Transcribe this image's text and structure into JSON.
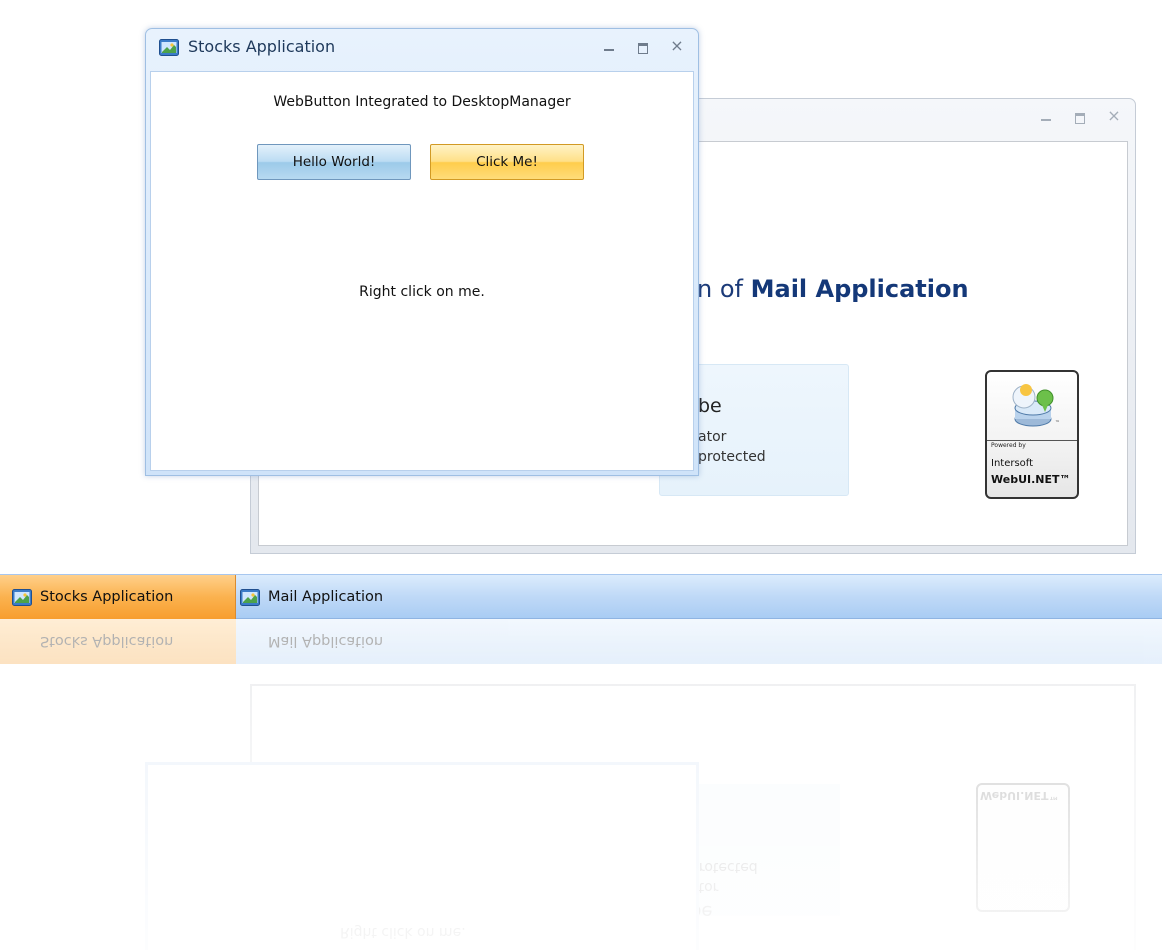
{
  "windows": {
    "stocks": {
      "title": "Stocks Application",
      "caption": "WebButton Integrated to DesktopManager",
      "hello_button": "Hello World!",
      "click_button": "Click Me!",
      "right_click_text": "Right click on me."
    },
    "mail": {
      "heading_partial": "n of ",
      "heading_app": "Mail Application",
      "welcome_title_partial": "be",
      "welcome_role_partial": "ator",
      "welcome_note_partial": "protected",
      "powered_by": "Powered by",
      "powered_company": "Intersoft",
      "powered_product": "WebUI.NET™",
      "powered_tm": "™"
    }
  },
  "taskbar": {
    "items": [
      {
        "label": "Stocks Application",
        "active": true
      },
      {
        "label": "Mail Application",
        "active": false
      }
    ]
  },
  "window_controls": {
    "minimize": "minimize",
    "maximize": "maximize",
    "close": "×"
  },
  "colors": {
    "active_tab": "#f79e2e",
    "taskbar": "#bfd9f7",
    "heading": "#1b3a78",
    "hello_button": "#bcdcf3",
    "click_button": "#ffe088"
  },
  "icons": {
    "app_icon": "application-window-icon"
  }
}
